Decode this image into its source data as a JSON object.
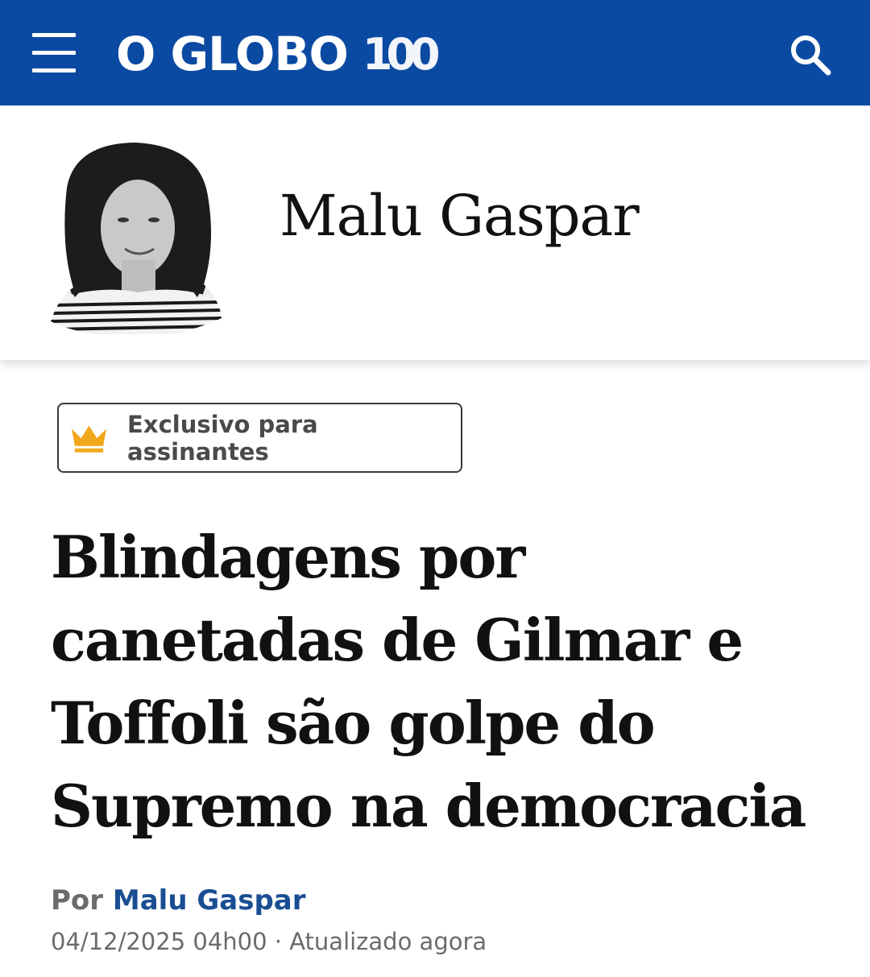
{
  "header": {
    "logo_text": "O GLOBO",
    "logo_badge": "100",
    "menu_icon": "hamburger-menu-icon",
    "search_icon": "search-icon",
    "background_color": "#0b4aa2"
  },
  "author": {
    "name": "Malu Gaspar",
    "avatar_icon": "author-portrait"
  },
  "badge": {
    "label": "Exclusivo para assinantes",
    "icon": "crown-icon",
    "icon_color": "#f2a81d"
  },
  "article": {
    "headline": "Blindagens por canetadas de Gilmar e Toffoli são golpe do Supremo na democracia",
    "byline_prefix": "Por",
    "byline_author": "Malu Gaspar",
    "date": "04/12/2025 04h00",
    "separator": "·",
    "updated": "Atualizado agora",
    "link_color": "#1a4e93"
  }
}
